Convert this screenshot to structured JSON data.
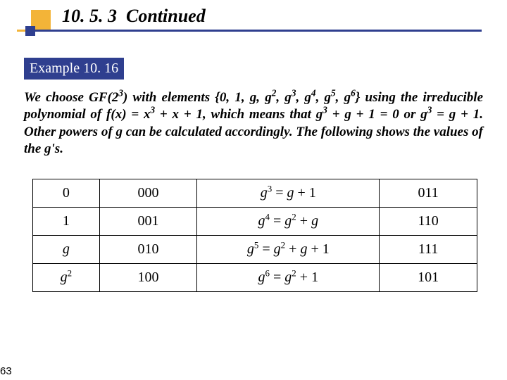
{
  "header": {
    "section_number": "10. 5. 3",
    "section_word": "Continued"
  },
  "example": {
    "label": "Example 10. 16",
    "paragraph_html": "We choose GF(2<sup>3</sup>) with elements {0, 1, g, g<sup>2</sup>, g<sup>3</sup>, g<sup>4</sup>, g<sup>5</sup>, g<sup>6</sup>} using the irreducible polynomial of f(x) = x<sup>3</sup> + x + 1, which means that g<sup>3</sup> + g + 1 = 0 or g<sup>3</sup> = g + 1. Other powers of g can be calculated accordingly. The following shows the values of the g's."
  },
  "chart_data": {
    "type": "table",
    "title": "Values of powers of g in GF(2^3)",
    "columns": [
      "element_left",
      "binary_left",
      "element_right",
      "binary_right"
    ],
    "rows": [
      {
        "element_left": "0",
        "binary_left": "000",
        "element_right_html": "<span class='ex'>g</span><sup>3</sup> = <span class='ex'>g</span> + 1",
        "binary_right": "011"
      },
      {
        "element_left": "1",
        "binary_left": "001",
        "element_right_html": "<span class='ex'>g</span><sup>4</sup> = <span class='ex'>g</span><sup>2</sup> + <span class='ex'>g</span>",
        "binary_right": "110"
      },
      {
        "element_left_html": "<span class='ex'>g</span>",
        "binary_left": "010",
        "element_right_html": "<span class='ex'>g</span><sup>5</sup> = <span class='ex'>g</span><sup>2</sup> + <span class='ex'>g</span> + 1",
        "binary_right": "111"
      },
      {
        "element_left_html": "<span class='ex'>g</span><sup>2</sup>",
        "binary_left": "100",
        "element_right_html": "<span class='ex'>g</span><sup>6</sup> = <span class='ex'>g</span><sup>2</sup> + 1",
        "binary_right": "101"
      }
    ]
  },
  "page_number": "63"
}
